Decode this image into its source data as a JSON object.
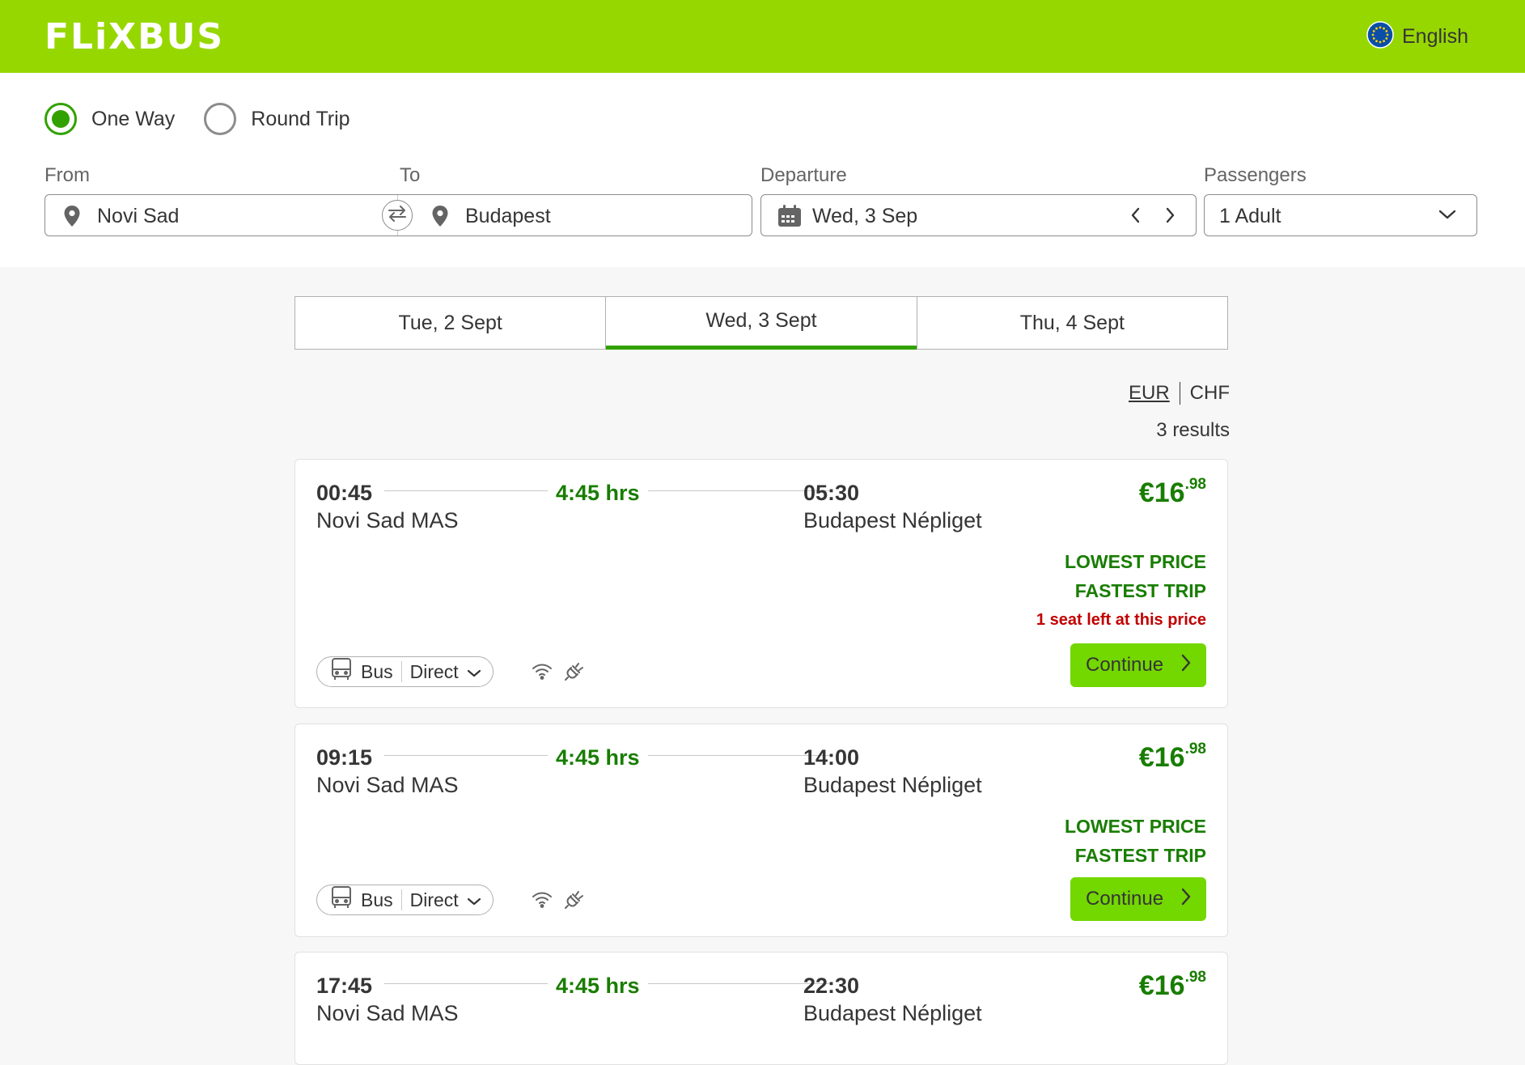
{
  "header": {
    "logo": "FLiXBUS",
    "language": "English"
  },
  "search": {
    "trip_types": [
      {
        "label": "One Way",
        "selected": true
      },
      {
        "label": "Round Trip",
        "selected": false
      }
    ],
    "from_label": "From",
    "from_value": "Novi Sad",
    "to_label": "To",
    "to_value": "Budapest",
    "departure_label": "Departure",
    "departure_value": "Wed, 3 Sep",
    "passengers_label": "Passengers",
    "passengers_value": "1 Adult"
  },
  "date_tabs": [
    {
      "label": "Tue, 2 Sept",
      "active": false
    },
    {
      "label": "Wed, 3 Sept",
      "active": true
    },
    {
      "label": "Thu, 4 Sept",
      "active": false
    }
  ],
  "currency": {
    "primary": "EUR",
    "secondary": "CHF"
  },
  "results_count": "3 results",
  "trips": [
    {
      "dep_time": "00:45",
      "dep_station": "Novi Sad MAS",
      "duration": "4:45 hrs",
      "arr_time": "05:30",
      "arr_station": "Budapest Népliget",
      "price_main": "€16",
      "price_cents": ".98",
      "tags": [
        "LOWEST PRICE",
        "FASTEST TRIP"
      ],
      "seats_note": "1 seat left at this price",
      "transport": "Bus",
      "connection": "Direct",
      "button": "Continue"
    },
    {
      "dep_time": "09:15",
      "dep_station": "Novi Sad MAS",
      "duration": "4:45 hrs",
      "arr_time": "14:00",
      "arr_station": "Budapest Népliget",
      "price_main": "€16",
      "price_cents": ".98",
      "tags": [
        "LOWEST PRICE",
        "FASTEST TRIP"
      ],
      "transport": "Bus",
      "connection": "Direct",
      "button": "Continue"
    },
    {
      "dep_time": "17:45",
      "dep_station": "Novi Sad MAS",
      "duration": "4:45 hrs",
      "arr_time": "22:30",
      "arr_station": "Budapest Népliget",
      "price_main": "€16",
      "price_cents": ".98"
    }
  ],
  "colors": {
    "brand": "#97d700",
    "button": "#73d700",
    "accent": "#31a100",
    "text_green": "#187d00",
    "alert": "#c10000"
  },
  "icons": [
    "globe-icon",
    "location-pin-icon",
    "swap-icon",
    "calendar-icon",
    "chevron-left-icon",
    "chevron-right-icon",
    "chevron-down-icon",
    "bus-icon",
    "wifi-icon",
    "power-plug-icon"
  ]
}
